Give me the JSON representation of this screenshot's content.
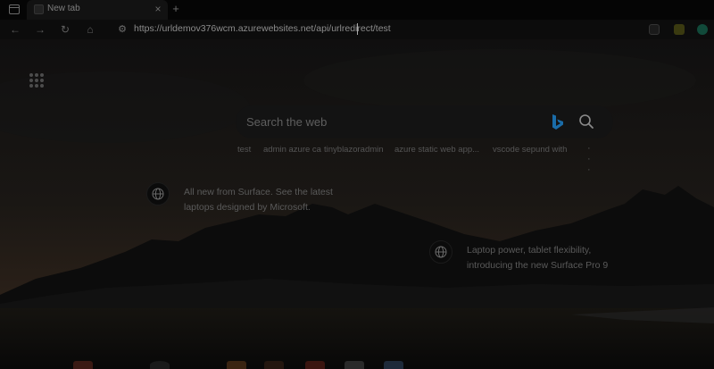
{
  "browser": {
    "tab": {
      "title": "New tab"
    },
    "address_bar": {
      "url": "https://urldemov376wcm.azurewebsites.net/api/urlredirect/test"
    }
  },
  "new_tab_page": {
    "search": {
      "placeholder": "Search the web"
    },
    "suggestions": [
      "test",
      "admin azure ca",
      "tinyblazoradmin",
      "azure static web app...",
      "vscode sepund with"
    ],
    "cards": [
      {
        "text": "All new from Surface. See the latest laptops designed by Microsoft.",
        "icon": "globe-icon"
      },
      {
        "text": "Laptop power, tablet flexibility, introducing the new Surface Pro 9",
        "icon": "globe-icon"
      }
    ]
  },
  "colors": {
    "overlay": "#000000",
    "text_dim": "#5a5a5a",
    "bing_blue": "#1a6ca8"
  }
}
